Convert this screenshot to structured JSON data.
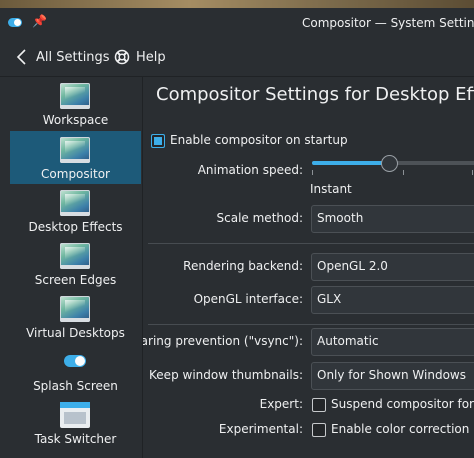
{
  "window": {
    "title": "Compositor  — System Settings"
  },
  "nav": {
    "back_label": "All Settings",
    "help_label": "Help"
  },
  "sidebar": {
    "items": [
      {
        "label": "Workspace",
        "icon": "workspace-icon"
      },
      {
        "label": "Compositor",
        "icon": "compositor-icon",
        "active": true
      },
      {
        "label": "Desktop Effects",
        "icon": "desktop-effects-icon"
      },
      {
        "label": "Screen Edges",
        "icon": "screen-edges-icon"
      },
      {
        "label": "Virtual Desktops",
        "icon": "virtual-desktops-icon"
      },
      {
        "label": "Splash Screen",
        "icon": "splash-screen-icon"
      },
      {
        "label": "Task Switcher",
        "icon": "task-switcher-icon"
      }
    ]
  },
  "main": {
    "title": "Compositor Settings for Desktop Effects",
    "enable_on_startup": {
      "label": "Enable compositor on startup",
      "checked": true
    },
    "animation_speed": {
      "label": "Animation speed:",
      "min_label": "Instant",
      "level": 0.46
    },
    "scale_method": {
      "label": "Scale method:",
      "value": "Smooth"
    },
    "rendering_backend": {
      "label": "Rendering backend:",
      "value": "OpenGL 2.0"
    },
    "opengl_interface": {
      "label": "OpenGL interface:",
      "value": "GLX"
    },
    "tearing_prevention": {
      "label": "Tearing prevention (\"vsync\"):",
      "value": "Automatic"
    },
    "keep_thumbnails": {
      "label": "Keep window thumbnails:",
      "value": "Only for Shown Windows"
    },
    "expert": {
      "label": "Expert:",
      "option": "Suspend compositor for fu",
      "checked": false
    },
    "experimental": {
      "label": "Experimental:",
      "option": "Enable color correction",
      "checked": false
    }
  },
  "colors": {
    "accent": "#3daee9",
    "background": "#2a2e32",
    "selection": "#1d5a79"
  }
}
